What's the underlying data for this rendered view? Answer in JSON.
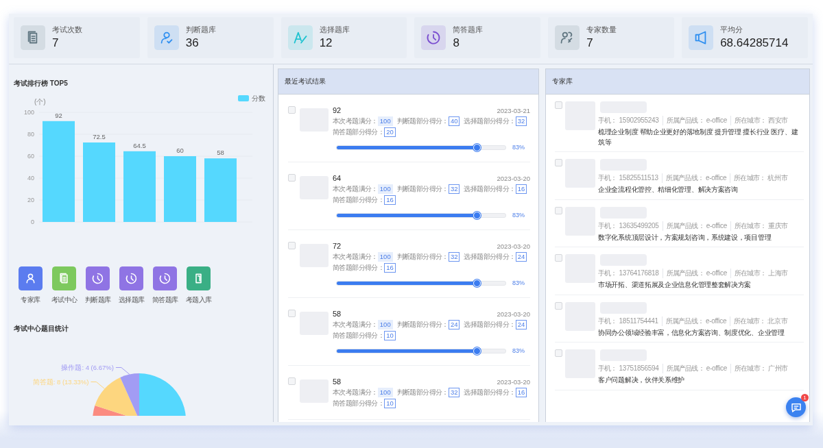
{
  "stats": [
    {
      "label": "考试次数",
      "value": "7",
      "kind": "documents",
      "color": "#5f7580"
    },
    {
      "label": "判断题库",
      "value": "36",
      "kind": "person-check",
      "color": "#2f8ff0"
    },
    {
      "label": "选择题库",
      "value": "12",
      "kind": "letter-a",
      "color": "#1ec3d0"
    },
    {
      "label": "简答题库",
      "value": "8",
      "kind": "clock",
      "color": "#7b4fd0"
    },
    {
      "label": "专家数量",
      "value": "7",
      "kind": "people",
      "color": "#5f7580"
    },
    {
      "label": "平均分",
      "value": "68.64285714",
      "kind": "speaker",
      "color": "#2f8ff0"
    }
  ],
  "ranking": {
    "title": "考试排行榜 TOP5",
    "chart_data": {
      "type": "bar",
      "ylabel": "(个)",
      "ylim": [
        0,
        100
      ],
      "yticks": [
        0,
        20,
        40,
        60,
        80,
        100
      ],
      "series": [
        {
          "name": "分数",
          "color": "#55d8fe",
          "values": [
            92,
            72.5,
            64.5,
            60,
            58
          ]
        }
      ],
      "data_labels": true
    }
  },
  "shortcuts": [
    {
      "label": "专家库",
      "kind": "person",
      "color": "#5b7cef"
    },
    {
      "label": "考试中心",
      "kind": "documents",
      "color": "#7dc95e"
    },
    {
      "label": "判断题库",
      "kind": "clock",
      "color": "#8f74e4"
    },
    {
      "label": "选择题库",
      "kind": "clock",
      "color": "#8f74e4"
    },
    {
      "label": "简答题库",
      "kind": "clock",
      "color": "#8f74e4"
    },
    {
      "label": "考题入库",
      "kind": "book",
      "color": "#3aaf85"
    }
  ],
  "question_stats": {
    "title": "考试中心题目统计",
    "chart_data": {
      "type": "pie",
      "values": [
        36,
        12,
        8,
        4
      ],
      "colors": [
        "#55d8fe",
        "#fb8b80",
        "#fdd67f",
        "#a29cf4"
      ],
      "value_labels": [
        null,
        null,
        "简答题: 8 (13.33%)",
        "操作题: 4 (6.67%)"
      ]
    }
  },
  "exams": {
    "title": "最近考试结果",
    "items": [
      {
        "checked": false,
        "score": "92",
        "date": "2023-03-21",
        "scores": [
          {
            "label": "本次考题满分：",
            "value": "100",
            "kind": "total"
          },
          {
            "label": "判断题部分得分：",
            "value": "40",
            "kind": "part"
          },
          {
            "label": "选择题部分得分：",
            "value": "32",
            "kind": "part"
          },
          {
            "label": "简答题部分得分：",
            "value": "20",
            "kind": "part"
          }
        ],
        "level": 0.83,
        "percent": "83%"
      },
      {
        "checked": false,
        "score": "64",
        "date": "2023-03-20",
        "scores": [
          {
            "label": "本次考题满分：",
            "value": "100",
            "kind": "total"
          },
          {
            "label": "判断题部分得分：",
            "value": "32",
            "kind": "part"
          },
          {
            "label": "选择题部分得分：",
            "value": "16",
            "kind": "part"
          },
          {
            "label": "简答题部分得分：",
            "value": "16",
            "kind": "part"
          }
        ],
        "level": 0.83,
        "percent": "83%"
      },
      {
        "checked": false,
        "score": "72",
        "date": "2023-03-20",
        "scores": [
          {
            "label": "本次考题满分：",
            "value": "100",
            "kind": "total"
          },
          {
            "label": "判断题部分得分：",
            "value": "32",
            "kind": "part"
          },
          {
            "label": "选择题部分得分：",
            "value": "24",
            "kind": "part"
          },
          {
            "label": "简答题部分得分：",
            "value": "16",
            "kind": "part"
          }
        ],
        "level": 0.83,
        "percent": "83%"
      },
      {
        "checked": false,
        "score": "58",
        "date": "2023-03-20",
        "scores": [
          {
            "label": "本次考题满分：",
            "value": "100",
            "kind": "total"
          },
          {
            "label": "判断题部分得分：",
            "value": "24",
            "kind": "part"
          },
          {
            "label": "选择题部分得分：",
            "value": "24",
            "kind": "part"
          },
          {
            "label": "简答题部分得分：",
            "value": "10",
            "kind": "part"
          }
        ],
        "level": 0.83,
        "percent": "83%"
      },
      {
        "checked": false,
        "score": "58",
        "date": "2023-03-20",
        "scores": [
          {
            "label": "本次考题满分：",
            "value": "100",
            "kind": "total"
          },
          {
            "label": "判断题部分得分：",
            "value": "32",
            "kind": "part"
          },
          {
            "label": "选择题部分得分：",
            "value": "16",
            "kind": "part"
          },
          {
            "label": "简答题部分得分：",
            "value": "10",
            "kind": "part"
          }
        ]
      }
    ]
  },
  "experts": {
    "title": "专家库",
    "items": [
      {
        "checked": false,
        "fields": [
          {
            "label": "手机：",
            "value": "15902955243"
          },
          {
            "label": "所属产品线：",
            "value": "e-office"
          },
          {
            "label": "所在城市：",
            "value": "西安市"
          }
        ],
        "description": "梳理企业制度 帮助企业更好的落地制度 提升管理 擅长行业 医疗、建筑等"
      },
      {
        "checked": false,
        "fields": [
          {
            "label": "手机：",
            "value": "15825511513"
          },
          {
            "label": "所属产品线：",
            "value": "e-office"
          },
          {
            "label": "所在城市：",
            "value": "杭州市"
          }
        ],
        "description": "企业全流程化管控、精细化管理、解决方案咨询"
      },
      {
        "checked": false,
        "fields": [
          {
            "label": "手机：",
            "value": "13635499205"
          },
          {
            "label": "所属产品线：",
            "value": "e-office"
          },
          {
            "label": "所在城市：",
            "value": "重庆市"
          }
        ],
        "description": "数字化系统顶层设计，方案规划咨询，系统建设，项目管理"
      },
      {
        "checked": false,
        "fields": [
          {
            "label": "手机：",
            "value": "13764176818"
          },
          {
            "label": "所属产品线：",
            "value": "e-office"
          },
          {
            "label": "所在城市：",
            "value": "上海市"
          }
        ],
        "description": "市场开拓、渠道拓展及企业信息化管理整套解决方案"
      },
      {
        "checked": false,
        "fields": [
          {
            "label": "手机：",
            "value": "18511754441"
          },
          {
            "label": "所属产品线：",
            "value": "e-office"
          },
          {
            "label": "所在城市：",
            "value": "北京市"
          }
        ],
        "description": "协同办公领域经验丰富，信息化方案咨询、制度优化、企业管理"
      },
      {
        "checked": false,
        "fields": [
          {
            "label": "手机：",
            "value": "13751856594"
          },
          {
            "label": "所属产品线：",
            "value": "e-office"
          },
          {
            "label": "所在城市：",
            "value": "广州市"
          }
        ],
        "description": "客户问题解决，伙伴关系维护"
      }
    ]
  },
  "chat": {
    "badge": "1"
  }
}
